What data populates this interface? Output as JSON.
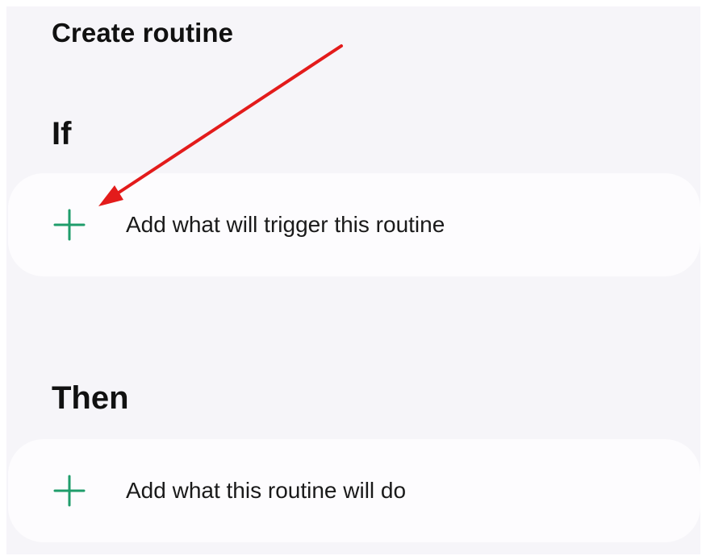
{
  "header": {
    "title": "Create routine"
  },
  "if_section": {
    "title": "If",
    "add_trigger_label": "Add what will trigger this routine"
  },
  "then_section": {
    "title": "Then",
    "add_action_label": "Add what this routine will do"
  },
  "colors": {
    "background": "#f6f5f9",
    "card": "#fdfcfe",
    "plus_accent": "#1f9d6b",
    "annotation_arrow": "#e31b1b"
  },
  "icons": {
    "add_trigger": "plus-icon",
    "add_action": "plus-icon",
    "annotation": "arrow-annotation"
  }
}
